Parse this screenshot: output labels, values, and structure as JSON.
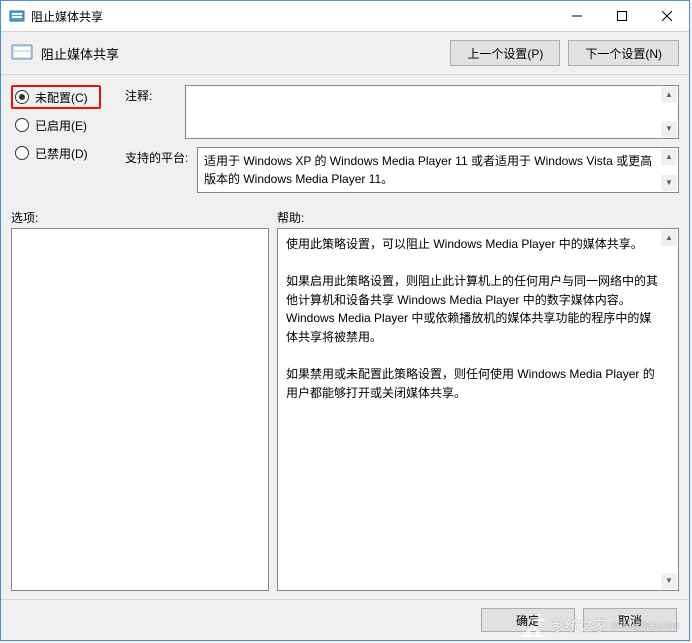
{
  "window": {
    "title": "阻止媒体共享"
  },
  "header": {
    "title": "阻止媒体共享",
    "prev_button": "上一个设置(P)",
    "next_button": "下一个设置(N)"
  },
  "radios": {
    "not_configured": "未配置(C)",
    "enabled": "已启用(E)",
    "disabled": "已禁用(D)",
    "selected": "not_configured"
  },
  "fields": {
    "comment_label": "注释:",
    "comment_value": "",
    "platform_label": "支持的平台:",
    "platform_value": "适用于 Windows XP 的 Windows Media Player 11 或者适用于 Windows Vista 或更高版本的 Windows Media Player 11。"
  },
  "sections": {
    "options_label": "选项:",
    "help_label": "帮助:"
  },
  "help_text": "使用此策略设置，可以阻止 Windows Media Player 中的媒体共享。\n\n如果启用此策略设置，则阻止此计算机上的任何用户与同一网络中的其他计算机和设备共享 Windows Media Player 中的数字媒体内容。Windows Media Player 中或依赖播放机的媒体共享功能的程序中的媒体共享将被禁用。\n\n如果禁用或未配置此策略设置，则任何使用 Windows Media Player 的用户都能够打开或关闭媒体共享。",
  "footer": {
    "ok": "确定",
    "cancel": "取消"
  },
  "watermark": {
    "text": "系统之家",
    "sub": "XiTongZhiJia.Net"
  }
}
